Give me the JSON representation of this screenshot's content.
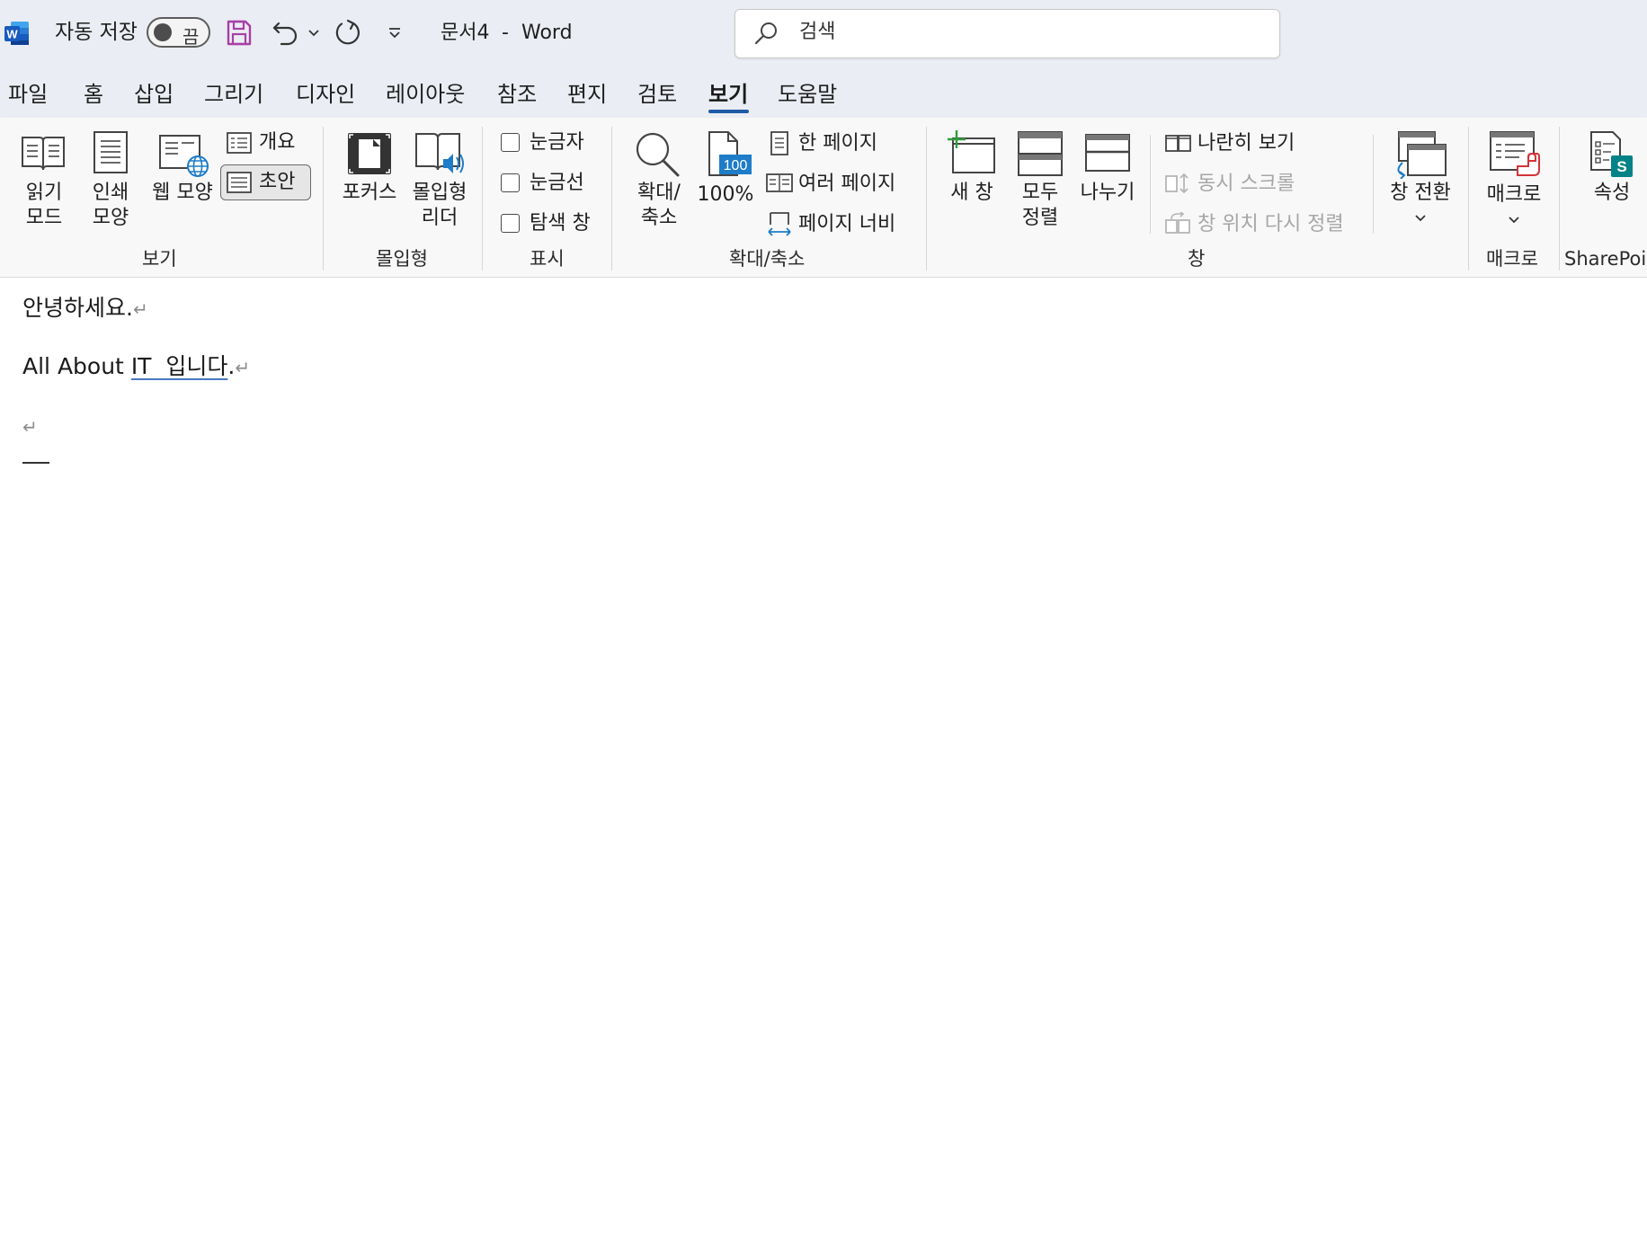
{
  "titlebar": {
    "autosave_label": "자동 저장",
    "autosave_state": "끔",
    "doc_title": "문서4",
    "title_sep": "-",
    "app_name": "Word",
    "search_placeholder": "검색"
  },
  "tabs": [
    "파일",
    "홈",
    "삽입",
    "그리기",
    "디자인",
    "레이아웃",
    "참조",
    "편지",
    "검토",
    "보기",
    "도움말"
  ],
  "active_tab": "보기",
  "ribbon": {
    "view_group": {
      "label": "보기",
      "reading_mode": [
        "읽기",
        "모드"
      ],
      "print_layout": [
        "인쇄",
        "모양"
      ],
      "web_layout": "웹 모양",
      "outline": "개요",
      "draft": "초안"
    },
    "immersive_group": {
      "label": "몰입형",
      "focus": "포커스",
      "immersive_reader": [
        "몰입형",
        "리더"
      ]
    },
    "show_group": {
      "label": "표시",
      "ruler": "눈금자",
      "gridlines": "눈금선",
      "navigation_pane": "탐색 창"
    },
    "zoom_group": {
      "label": "확대/축소",
      "zoom": [
        "확대/",
        "축소"
      ],
      "zoom_100": "100%",
      "zoom_100_icon_text": "100",
      "one_page": "한 페이지",
      "multiple_pages": "여러 페이지",
      "page_width": "페이지 너비"
    },
    "window_group": {
      "label": "창",
      "new_window": "새 창",
      "arrange_all": [
        "모두",
        "정렬"
      ],
      "split": "나누기",
      "side_by_side": "나란히 보기",
      "sync_scroll": "동시 스크롤",
      "reset_position": "창 위치 다시 정렬",
      "switch_windows": "창 전환"
    },
    "macros_group": {
      "label": "매크로",
      "macros": "매크로"
    },
    "sharepoint_group": {
      "label": "SharePoin",
      "properties": "속성",
      "icon_letter": "S"
    }
  },
  "document": {
    "line1": "안녕하세요.",
    "line2_prefix": "All About ",
    "line2_underlined": "IT  입니다",
    "line2_suffix": ".",
    "pilcrow": "↵"
  },
  "colors": {
    "titlebar_bg": "#eaedf3",
    "active_tab_underline": "#1f5aa6",
    "word_blue": "#185abd",
    "save_icon": "#a83fa6",
    "new_window_plus": "#2e9d3c",
    "sharepoint_teal": "#038387",
    "macro_red": "#d13438"
  }
}
